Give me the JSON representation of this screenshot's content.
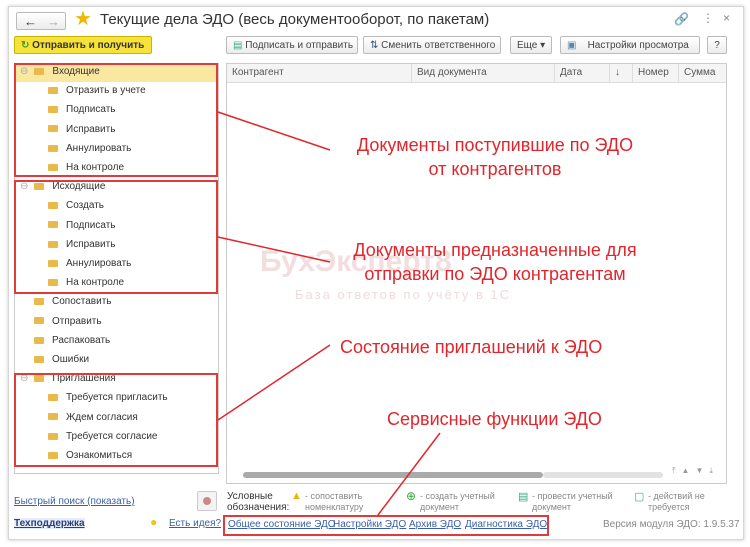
{
  "window": {
    "title": "Текущие дела ЭДО (весь документооборот, по пакетам)"
  },
  "toolbar": {
    "send_receive": "Отправить и получить",
    "sign_send": "Подписать и отправить",
    "change_resp": "Сменить ответственного",
    "more": "Еще",
    "view_settings": "Настройки просмотра",
    "help": "?"
  },
  "tree": {
    "incoming": {
      "label": "Входящие",
      "items": [
        "Отразить в учете",
        "Подписать",
        "Исправить",
        "Аннулировать",
        "На контроле"
      ]
    },
    "outgoing": {
      "label": "Исходящие",
      "items": [
        "Создать",
        "Подписать",
        "Исправить",
        "Аннулировать",
        "На контроле"
      ]
    },
    "other": [
      "Сопоставить",
      "Отправить",
      "Распаковать",
      "Ошибки"
    ],
    "invites": {
      "label": "Приглашения",
      "items": [
        "Требуется пригласить",
        "Ждем согласия",
        "Требуется согласие",
        "Ознакомиться"
      ]
    }
  },
  "grid": {
    "columns": [
      "Контрагент",
      "Вид документа",
      "Дата",
      "Номер",
      "Сумма"
    ],
    "sort_icon": "↓"
  },
  "legend": {
    "title": "Условные обозначения:",
    "items": [
      "- сопоставить номенклатуру",
      "- создать учетный документ",
      "- провести учетный документ",
      "- действий не требуется"
    ]
  },
  "footer": {
    "quick_search": "Быстрый поиск (показать)",
    "support": "Техподдержка",
    "idea": "Есть идея?",
    "links": [
      "Общее состояние ЭДО",
      "Настройки ЭДО",
      "Архив ЭДО",
      "Диагностика ЭДО"
    ],
    "version": "Версия модуля ЭДО: 1.9.5.37"
  },
  "annotations": [
    "Документы поступившие по ЭДО",
    "от контрагентов",
    "Документы предназначенные для",
    "отправки по ЭДО контрагентам",
    "Состояние приглашений к ЭДО",
    "Сервисные функции ЭДО"
  ],
  "watermark": {
    "title": "БухЭксперт8",
    "subtitle": "База ответов по учёту в 1С"
  }
}
